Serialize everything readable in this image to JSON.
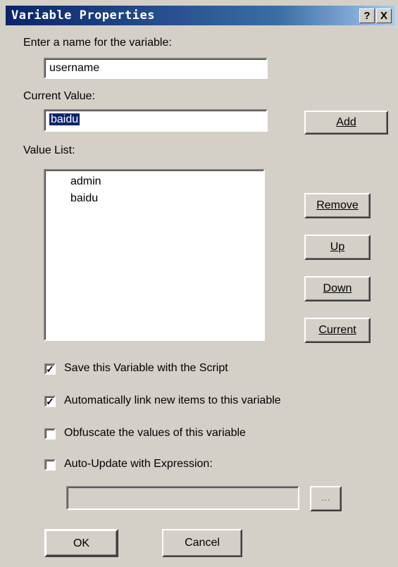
{
  "window": {
    "title": "Variable Properties",
    "help_label": "?",
    "close_label": "X"
  },
  "labels": {
    "name_prompt": "Enter a name for the variable:",
    "current_value": "Current Value:",
    "value_list": "Value List:"
  },
  "fields": {
    "name_value": "username",
    "current_value": "baidu",
    "expression_value": ""
  },
  "value_list": {
    "items": [
      "admin",
      "baidu"
    ]
  },
  "buttons": {
    "add": "Add",
    "remove": "Remove",
    "up": "Up",
    "down": "Down",
    "current": "Current",
    "browse": "...",
    "ok": "OK",
    "cancel": "Cancel"
  },
  "checkboxes": [
    {
      "label": "Save this Variable with the Script",
      "checked": true
    },
    {
      "label": "Automatically link new items to this variable",
      "checked": true
    },
    {
      "label": "Obfuscate the values of this variable",
      "checked": false
    },
    {
      "label": "Auto-Update with Expression:",
      "checked": false
    }
  ],
  "colors": {
    "title_bar_start": "#0a246a",
    "dialog_bg": "#d4d0c8",
    "selection": "#0a246a"
  }
}
